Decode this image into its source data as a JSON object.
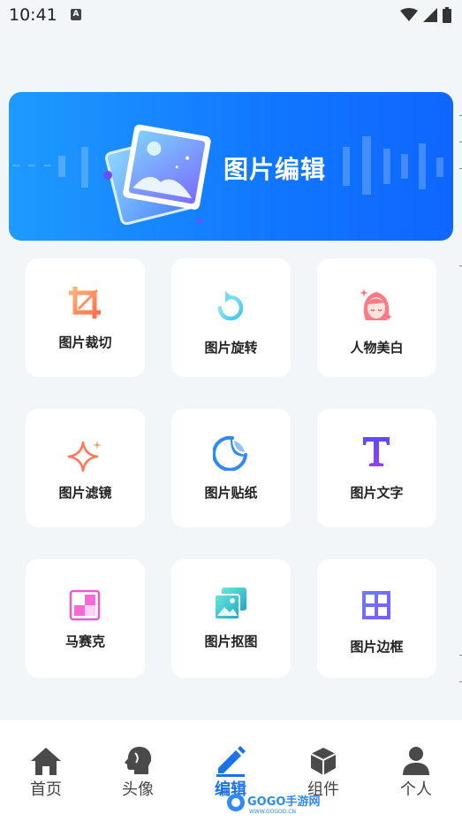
{
  "status_bar": {
    "time": "10:41",
    "a_badge": "A"
  },
  "banner": {
    "title": "图片编辑"
  },
  "tools": [
    {
      "label": "图片裁切",
      "icon": "crop-icon"
    },
    {
      "label": "图片旋转",
      "icon": "rotate-icon"
    },
    {
      "label": "人物美白",
      "icon": "face-whitening-icon"
    },
    {
      "label": "图片滤镜",
      "icon": "sparkle-filter-icon"
    },
    {
      "label": "图片贴纸",
      "icon": "sticker-icon"
    },
    {
      "label": "图片文字",
      "icon": "text-t-icon"
    },
    {
      "label": "马赛克",
      "icon": "mosaic-icon"
    },
    {
      "label": "图片抠图",
      "icon": "cutout-image-icon"
    },
    {
      "label": "图片边框",
      "icon": "frame-grid-icon"
    }
  ],
  "nav": [
    {
      "label": "首页",
      "icon": "home-icon",
      "active": false
    },
    {
      "label": "头像",
      "icon": "avatar-head-icon",
      "active": false
    },
    {
      "label": "编辑",
      "icon": "pencil-icon",
      "active": true
    },
    {
      "label": "组件",
      "icon": "cube-icon",
      "active": false
    },
    {
      "label": "个人",
      "icon": "person-icon",
      "active": false
    }
  ],
  "watermark": {
    "text": "GOGO手游网",
    "sub": "WWW.GOGOD.CN"
  },
  "colors": {
    "accent": "#1a73e8",
    "banner_start": "#1e9bff",
    "banner_end": "#0f66ff",
    "background": "#f2f6f9"
  }
}
